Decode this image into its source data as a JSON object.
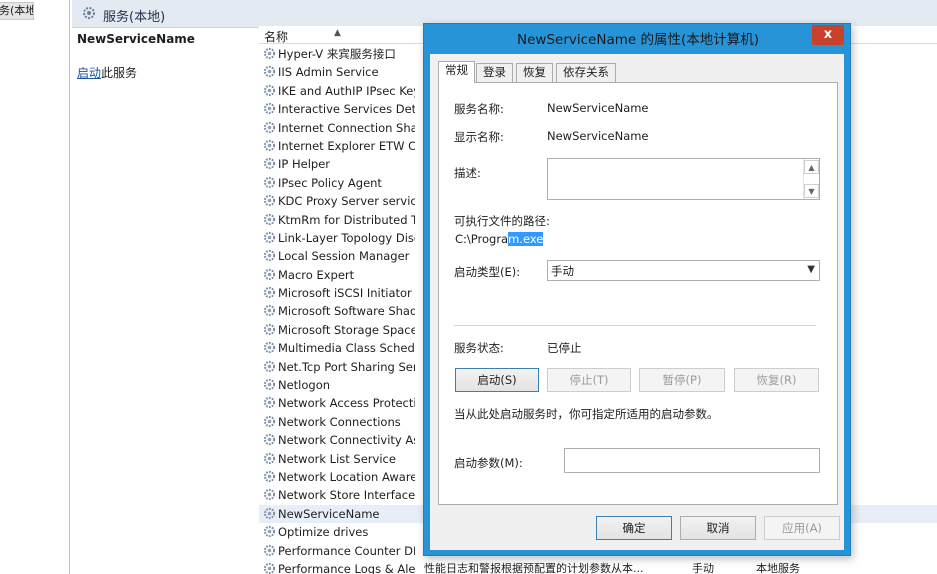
{
  "tree": {
    "item_label": "务(本地)"
  },
  "panel": {
    "title": "服务(本地)",
    "selected_service": "NewServiceName",
    "start_link": "启动",
    "start_suffix": "此服务"
  },
  "list": {
    "col_name": "名称",
    "rows": [
      {
        "name": "Hyper-V 来宾服务接口"
      },
      {
        "name": "IIS Admin Service"
      },
      {
        "name": "IKE and AuthIP IPsec Key..."
      },
      {
        "name": "Interactive Services Dete..."
      },
      {
        "name": "Internet Connection Shari..."
      },
      {
        "name": "Internet Explorer ETW C..."
      },
      {
        "name": "IP Helper"
      },
      {
        "name": "IPsec Policy Agent"
      },
      {
        "name": "KDC Proxy Server service..."
      },
      {
        "name": "KtmRm for Distributed Tr..."
      },
      {
        "name": "Link-Layer Topology Disc..."
      },
      {
        "name": "Local Session Manager"
      },
      {
        "name": "Macro Expert"
      },
      {
        "name": "Microsoft iSCSI Initiator ..."
      },
      {
        "name": "Microsoft Software Shad..."
      },
      {
        "name": "Microsoft Storage Space..."
      },
      {
        "name": "Multimedia Class Schedu..."
      },
      {
        "name": "Net.Tcp Port Sharing Ser..."
      },
      {
        "name": "Netlogon"
      },
      {
        "name": "Network Access Protecti..."
      },
      {
        "name": "Network Connections"
      },
      {
        "name": "Network Connectivity Ass..."
      },
      {
        "name": "Network List Service"
      },
      {
        "name": "Network Location Aware..."
      },
      {
        "name": "Network Store Interface ..."
      },
      {
        "name": "NewServiceName"
      },
      {
        "name": "Optimize drives"
      },
      {
        "name": "Performance Counter DL..."
      },
      {
        "name": "Performance Logs & Aler...",
        "desc": "性能日志和警报根据预配置的计划参数从本...",
        "startup": "手动",
        "logon": "本地服务"
      }
    ]
  },
  "dialog": {
    "title": "NewServiceName 的属性(本地计算机)",
    "close": "x",
    "tabs": [
      "常规",
      "登录",
      "恢复",
      "依存关系"
    ],
    "service_name_label": "服务名称:",
    "service_name_value": "NewServiceName",
    "display_name_label": "显示名称:",
    "display_name_value": "NewServiceName",
    "desc_label": "描述:",
    "path_label": "可执行文件的路径:",
    "path_value_a": "C:\\Progra",
    "path_value_b": "m.exe",
    "startup_type_label": "启动类型(E):",
    "startup_type_value": "手动",
    "status_label": "服务状态:",
    "status_value": "已停止",
    "btn_start": "启动(S)",
    "btn_stop": "停止(T)",
    "btn_pause": "暂停(P)",
    "btn_resume": "恢复(R)",
    "hint": "当从此处启动服务时，你可指定所适用的启动参数。",
    "param_label": "启动参数(M):",
    "btn_ok": "确定",
    "btn_cancel": "取消",
    "btn_apply": "应用(A)"
  }
}
